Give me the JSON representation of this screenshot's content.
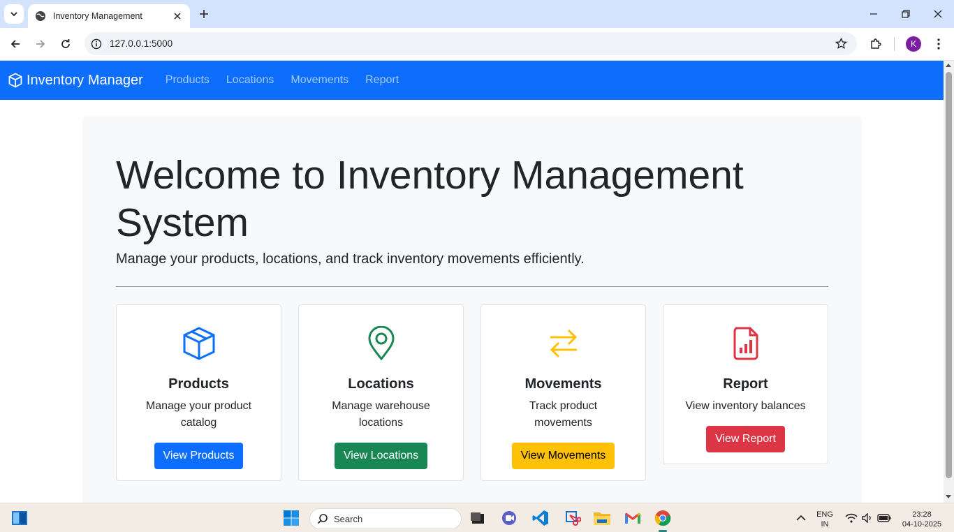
{
  "browser": {
    "tab_title": "Inventory Management",
    "url": "127.0.0.1:5000",
    "profile_initial": "K"
  },
  "navbar": {
    "brand": "Inventory Manager",
    "links": [
      "Products",
      "Locations",
      "Movements",
      "Report"
    ]
  },
  "hero": {
    "title": "Welcome to Inventory Management System",
    "lead": "Manage your products, locations, and track inventory movements efficiently."
  },
  "cards": [
    {
      "title": "Products",
      "text": "Manage your product catalog",
      "button": "View Products",
      "icon": "box-icon",
      "color": "#0d6efd"
    },
    {
      "title": "Locations",
      "text": "Manage warehouse locations",
      "button": "View Locations",
      "icon": "map-pin-icon",
      "color": "#198754"
    },
    {
      "title": "Movements",
      "text": "Track product movements",
      "button": "View Movements",
      "icon": "arrows-exchange-icon",
      "color": "#ffc107"
    },
    {
      "title": "Report",
      "text": "View inventory balances",
      "button": "View Report",
      "icon": "file-chart-icon",
      "color": "#dc3545"
    }
  ],
  "taskbar": {
    "search_placeholder": "Search",
    "lang_line1": "ENG",
    "lang_line2": "IN",
    "time": "23:28",
    "date": "04-10-2025"
  }
}
